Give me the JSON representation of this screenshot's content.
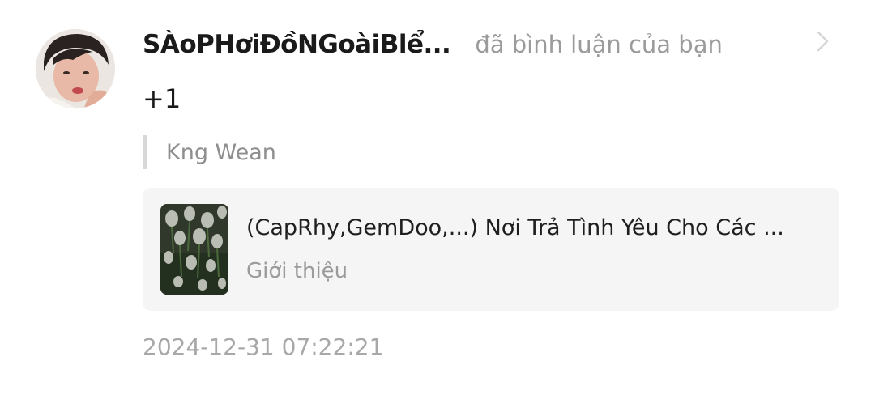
{
  "notification": {
    "username": "SÀoPHơiĐồNGoàiBlể...",
    "action_text": "đã bình luận của bạn",
    "comment": "+1",
    "quoted_text": "Kng Wean",
    "story_card": {
      "title": "(CapRhy,GemDoo,...) Nơi Trả Tình Yêu Cho Các ...",
      "subtitle": "Giới thiệu"
    },
    "timestamp": "2024-12-31 07:22:21",
    "icons": {
      "avatar": "user-avatar",
      "chevron": "chevron-right-icon",
      "cover": "story-cover-image"
    },
    "colors": {
      "primary_text": "#1a1a1a",
      "secondary_text": "#9b9b9b",
      "card_background": "#f5f5f5",
      "quote_bar": "#d8d8d8"
    }
  }
}
